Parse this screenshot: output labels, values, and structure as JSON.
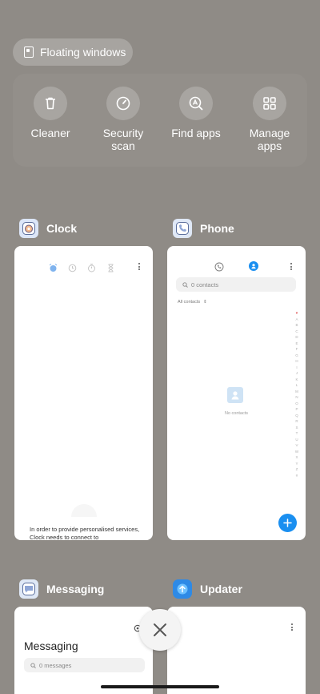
{
  "floating_windows": {
    "label": "Floating windows"
  },
  "quick_actions": [
    {
      "label": "Cleaner",
      "icon": "trash-icon"
    },
    {
      "label": "Security\nscan",
      "icon": "security-scan-icon"
    },
    {
      "label": "Find apps",
      "icon": "find-apps-icon"
    },
    {
      "label": "Manage\napps",
      "icon": "grid-icon"
    }
  ],
  "apps": {
    "clock": {
      "name": "Clock",
      "notice": "In order to provide personalised services, Clock needs to connect to"
    },
    "phone": {
      "name": "Phone",
      "search_placeholder": "0 contacts",
      "filter_label": "All contacts",
      "empty_label": "No contacts",
      "alphabet": [
        "♥",
        "A",
        "B",
        "C",
        "D",
        "E",
        "F",
        "G",
        "H",
        "I",
        "J",
        "K",
        "L",
        "M",
        "N",
        "O",
        "P",
        "Q",
        "R",
        "S",
        "T",
        "U",
        "V",
        "W",
        "X",
        "Y",
        "Z",
        "#"
      ]
    },
    "messaging": {
      "name": "Messaging",
      "title": "Messaging",
      "search_placeholder": "0 messages"
    },
    "updater": {
      "name": "Updater"
    }
  },
  "colors": {
    "background": "#8f8b86",
    "accent_blue": "#1a8ff0",
    "clock_icon_bg": "#dce6f8",
    "updater_icon_bg": "#2e8ae6"
  }
}
